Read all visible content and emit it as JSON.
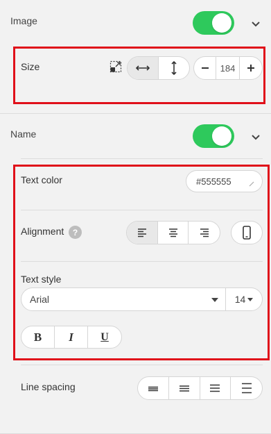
{
  "image_section": {
    "title": "Image",
    "enabled": true
  },
  "size": {
    "label": "Size",
    "value": "184"
  },
  "name_section": {
    "title": "Name",
    "enabled": true
  },
  "text_color": {
    "label": "Text color",
    "value": "#555555"
  },
  "alignment": {
    "label": "Alignment",
    "help": "?"
  },
  "text_style": {
    "label": "Text style",
    "font": "Arial",
    "font_size": "14"
  },
  "format_buttons": {
    "bold": "B",
    "italic": "I",
    "underline": "U"
  },
  "line_spacing": {
    "label": "Line spacing"
  },
  "colors": {
    "toggle_on": "#2ec95c",
    "highlight": "#e0101a"
  }
}
